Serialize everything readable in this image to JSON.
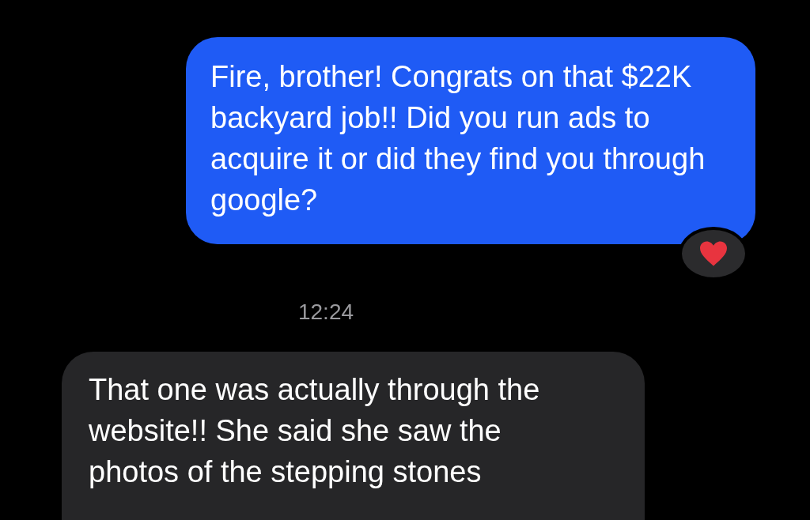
{
  "messages": [
    {
      "kind": "sent",
      "text": "Fire, brother! Congrats on that $22K backyard job!! Did you run ads to acquire it or did they find you through google?",
      "reaction": {
        "kind": "heart"
      }
    },
    {
      "kind": "timestamp",
      "text": "12:24"
    },
    {
      "kind": "received",
      "text": "That one was actually through the website!! She said she saw the photos of the stepping stones"
    }
  ]
}
